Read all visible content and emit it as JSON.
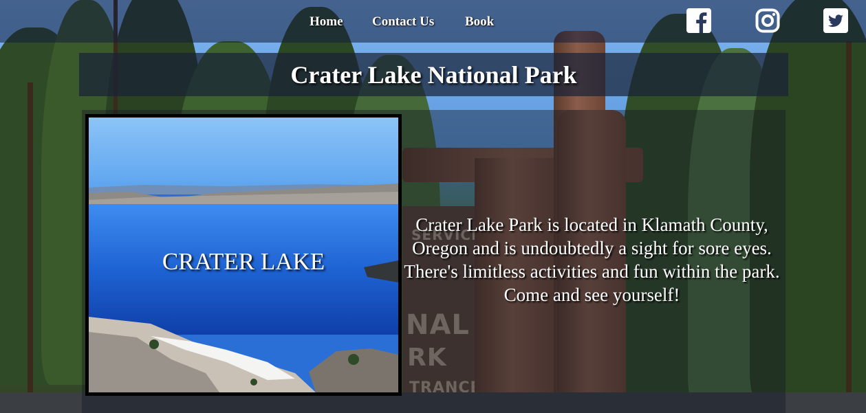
{
  "nav": {
    "links": [
      "Home",
      "Contact Us",
      "Book"
    ]
  },
  "social": {
    "icons": [
      "facebook-icon",
      "instagram-icon",
      "twitter-icon"
    ]
  },
  "header": {
    "title": "Crater Lake National Park"
  },
  "main": {
    "image_caption": "CRATER LAKE",
    "description": "Crater Lake Park is located in Klamath County, Oregon and is undoubtedly a sight for sore eyes. There's limitless activities and fun within the park. Come and see yourself!"
  },
  "colors": {
    "nav_bg": "#141e3c",
    "text": "#ffffff",
    "lake_blue": "#2a6fd6"
  }
}
